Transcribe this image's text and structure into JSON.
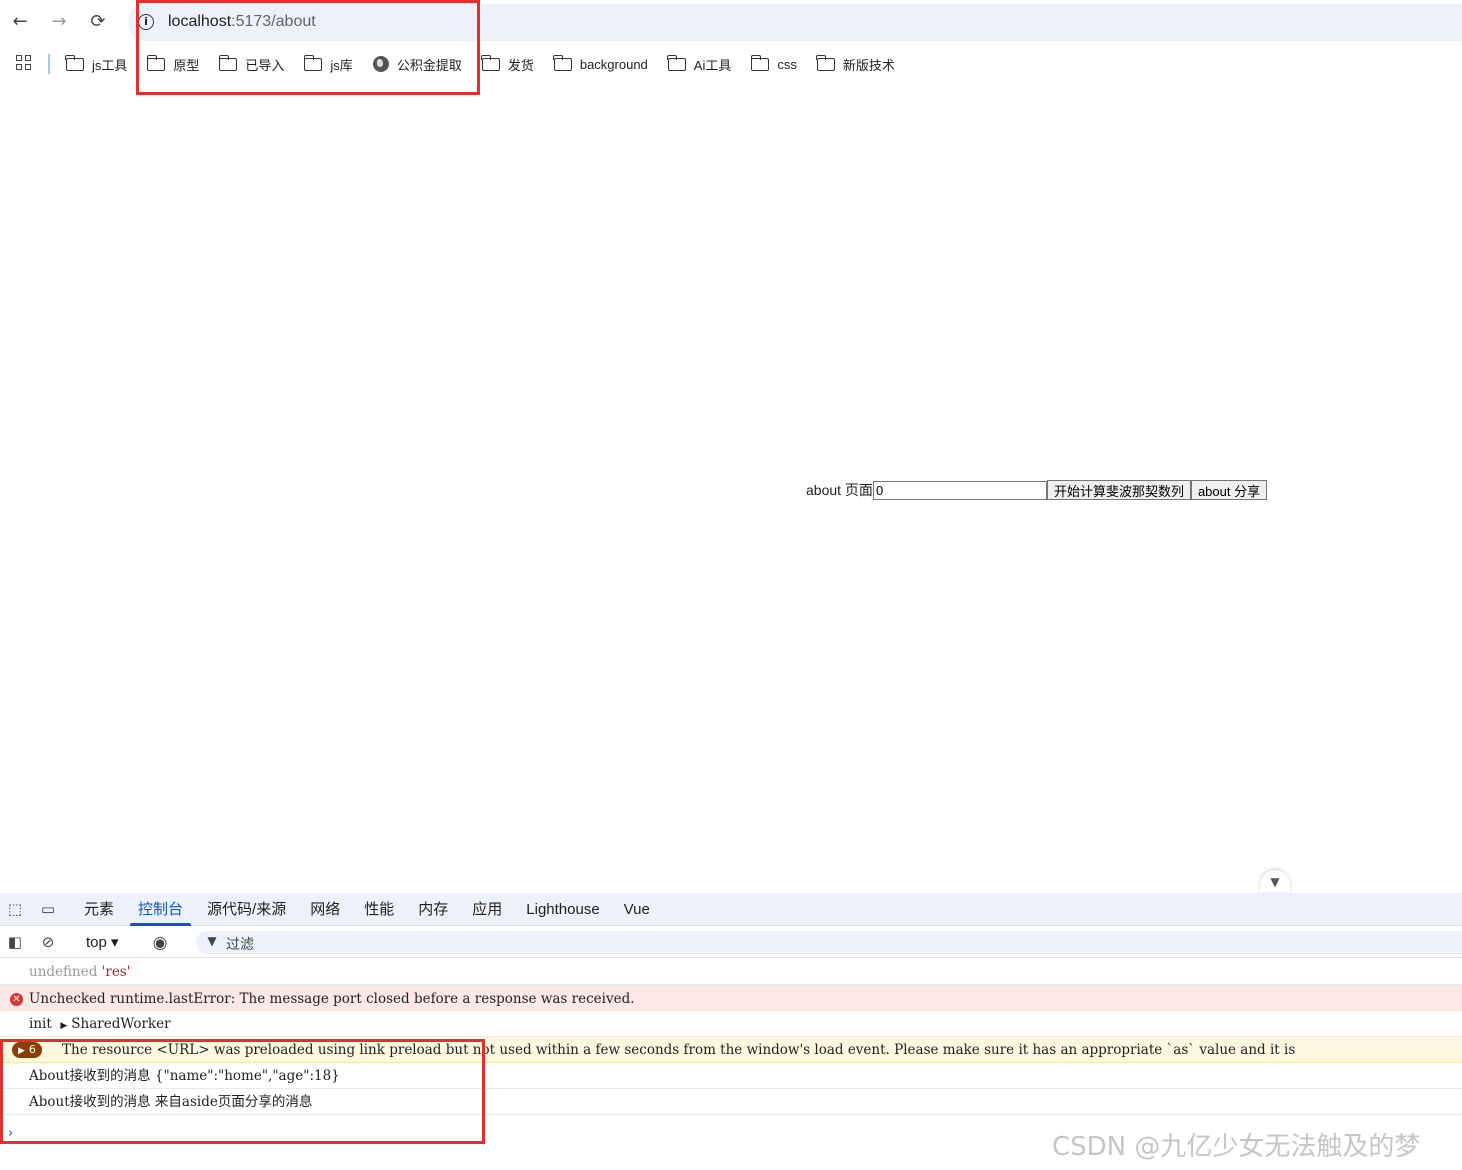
{
  "browser": {
    "back_icon": "←",
    "forward_icon": "→",
    "reload_icon": "⟳",
    "url_host": "localhost",
    "url_path": ":5173/about"
  },
  "bookmarks": [
    {
      "label": "js工具",
      "icon": "folder"
    },
    {
      "label": "原型",
      "icon": "folder"
    },
    {
      "label": "已导入",
      "icon": "folder"
    },
    {
      "label": "js库",
      "icon": "folder"
    },
    {
      "label": "公积金提取",
      "icon": "globe"
    },
    {
      "label": "发货",
      "icon": "folder"
    },
    {
      "label": "background",
      "icon": "folder"
    },
    {
      "label": "Ai工具",
      "icon": "folder"
    },
    {
      "label": "css",
      "icon": "folder"
    },
    {
      "label": "新版技术",
      "icon": "folder"
    }
  ],
  "page": {
    "label": "about 页面",
    "input_value": "0",
    "fib_button": "开始计算斐波那契数列",
    "share_button": "about 分享"
  },
  "devtools": {
    "tabs": [
      "元素",
      "控制台",
      "源代码/来源",
      "网络",
      "性能",
      "内存",
      "应用",
      "Lighthouse",
      "Vue"
    ],
    "active_tab": "控制台",
    "context": "top",
    "context_caret": "▾",
    "filter_placeholder": "过滤",
    "console": {
      "line1_a": "undefined",
      "line1_b": "'res'",
      "error_text": "Unchecked runtime.lastError: The message port closed before a response was received.",
      "init_a": "init",
      "init_b": "SharedWorker",
      "warn_count": "6",
      "warn_text": "The resource <URL> was preloaded using link preload but not used within a few seconds from the window's load event. Please make sure it has an appropriate `as` value and it is",
      "msg1": "About接收到的消息 {\"name\":\"home\",\"age\":18}",
      "msg2": "About接收到的消息 来自aside页面分享的消息"
    },
    "prompt_symbol": "›"
  },
  "watermark": "CSDN @九亿少女无法触及的梦",
  "colors": {
    "highlight_box": "#e62e2e",
    "active_tab": "#0b57d0",
    "error_bg": "#fce8e6",
    "warning_bg": "#fef7e0"
  }
}
